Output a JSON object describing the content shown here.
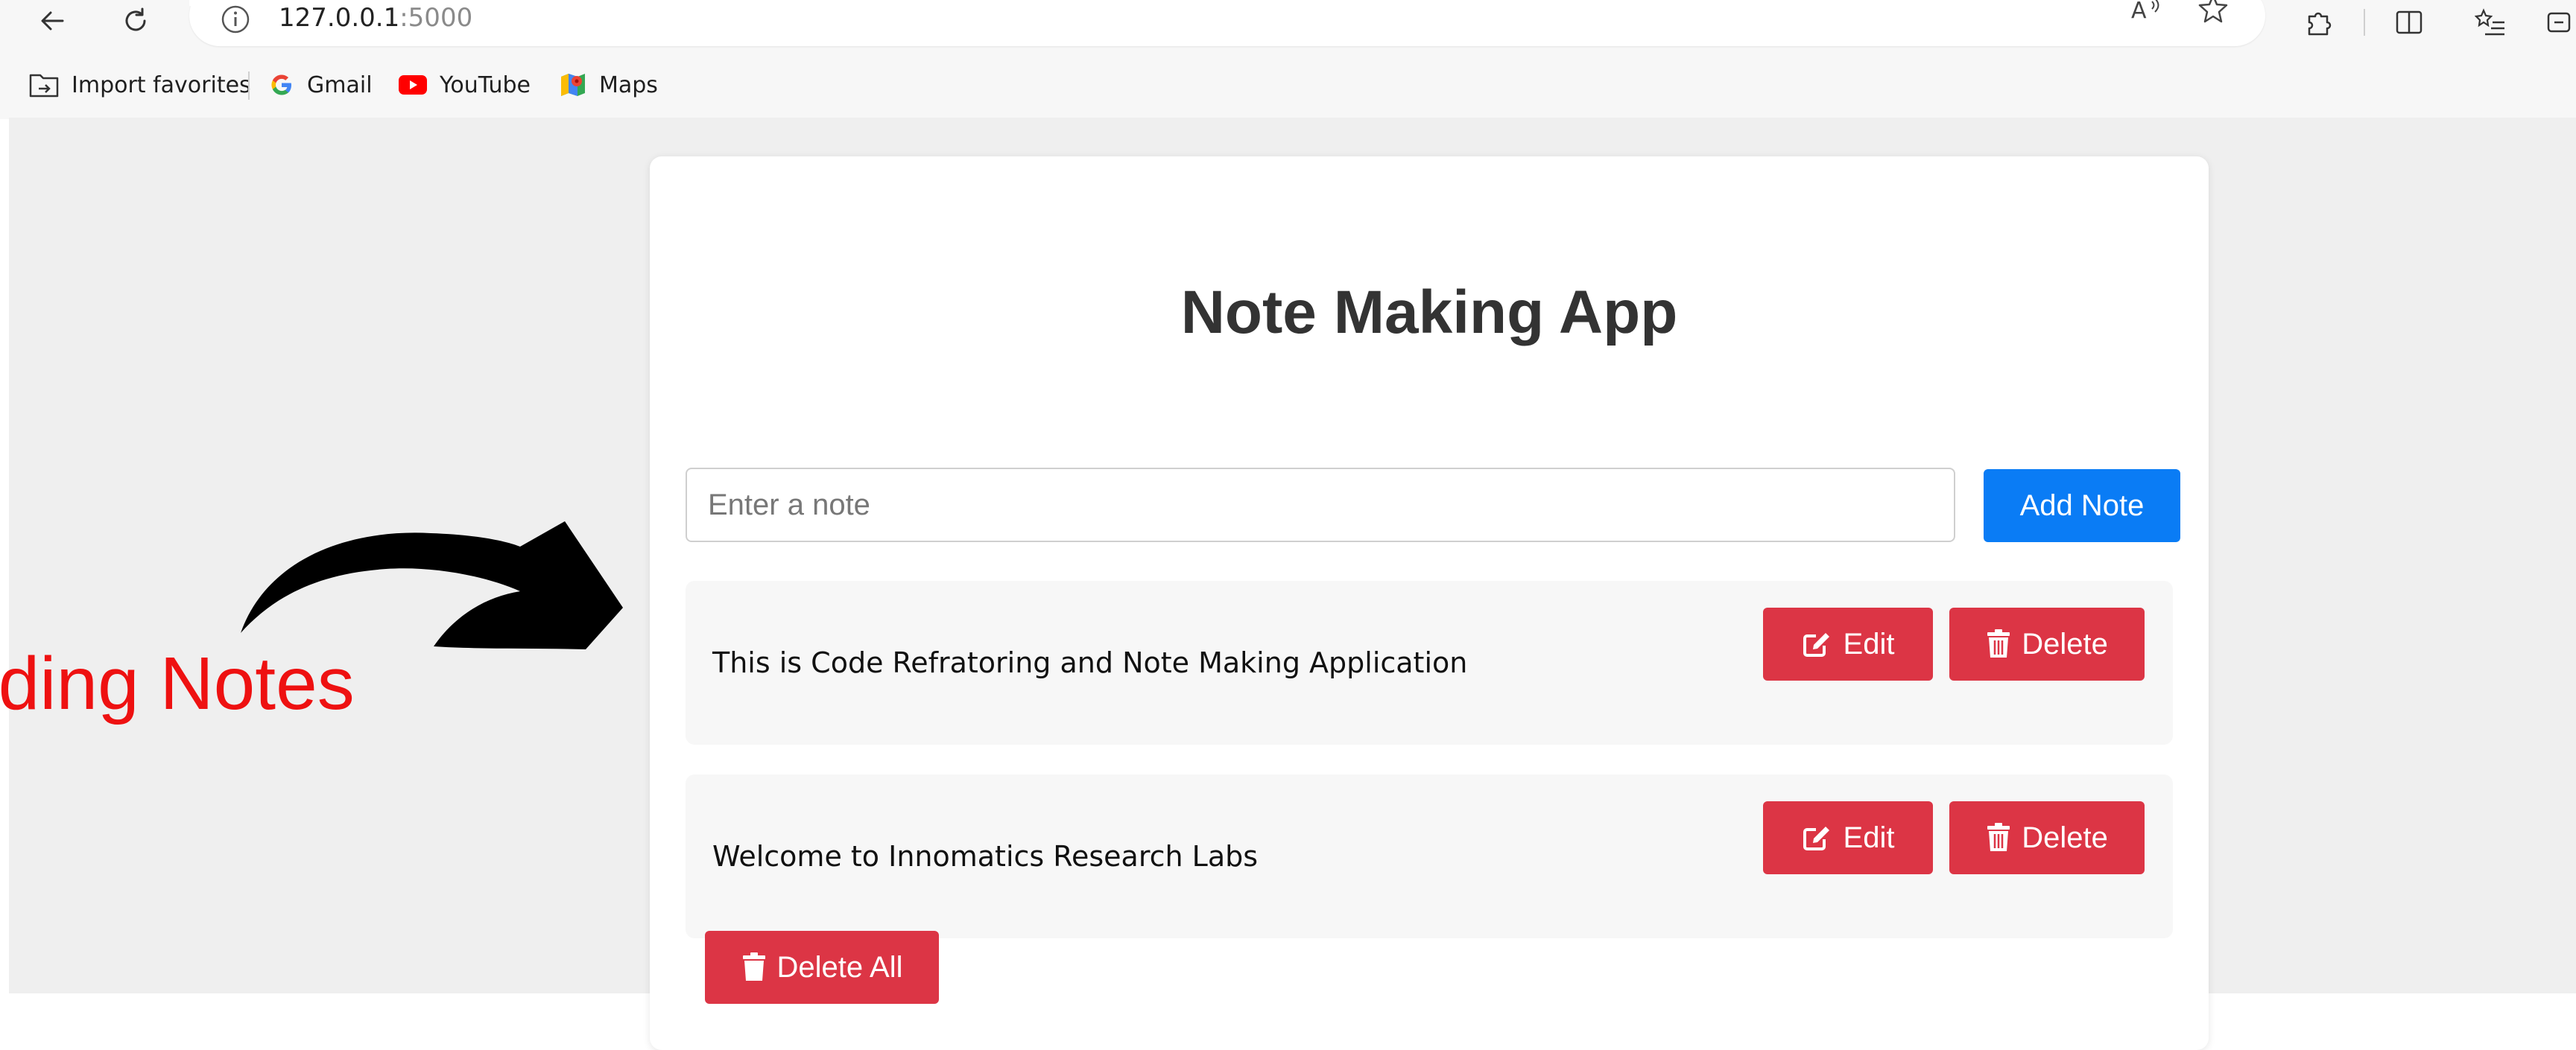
{
  "browser": {
    "url_host": "127.0.0.1",
    "url_port": ":5000",
    "favorites": [
      {
        "label": "Import favorites",
        "icon": "folder-import-icon"
      },
      {
        "label": "Gmail",
        "icon": "google-icon"
      },
      {
        "label": "YouTube",
        "icon": "youtube-icon"
      },
      {
        "label": "Maps",
        "icon": "maps-icon"
      }
    ]
  },
  "app": {
    "title": "Note Making App",
    "input_placeholder": "Enter a note",
    "input_value": "",
    "add_button_label": "Add Note",
    "notes": [
      {
        "text": "This is Code Refratoring and Note Making Application",
        "edit_label": "Edit",
        "delete_label": "Delete"
      },
      {
        "text": "Welcome to Innomatics Research Labs",
        "edit_label": "Edit",
        "delete_label": "Delete"
      }
    ],
    "delete_all_label": "Delete All"
  },
  "annotation": {
    "text": "dding Notes"
  },
  "colors": {
    "primary": "#0a7cf5",
    "danger": "#dc3545",
    "annotation": "#ee1111",
    "title": "#333333"
  }
}
